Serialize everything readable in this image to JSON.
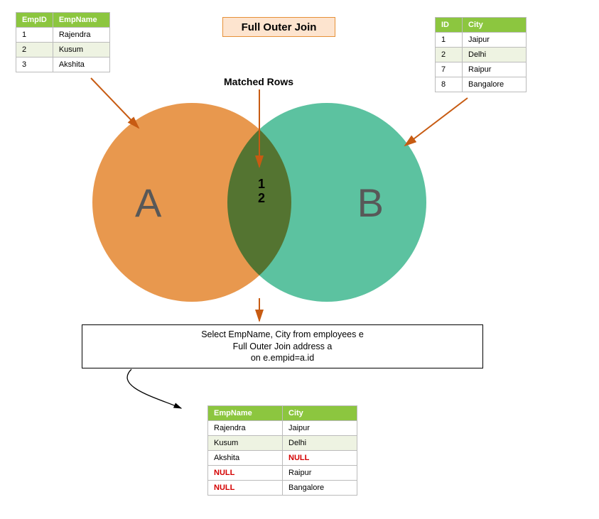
{
  "title": "Full Outer Join",
  "matched_label": "Matched Rows",
  "matched_values": [
    "1",
    "2"
  ],
  "venn": {
    "a_label": "A",
    "b_label": "B"
  },
  "left_table": {
    "headers": [
      "EmpID",
      "EmpName"
    ],
    "rows": [
      [
        "1",
        "Rajendra"
      ],
      [
        "2",
        "Kusum"
      ],
      [
        "3",
        "Akshita"
      ]
    ]
  },
  "right_table": {
    "headers": [
      "ID",
      "City"
    ],
    "rows": [
      [
        "1",
        "Jaipur"
      ],
      [
        "2",
        "Delhi"
      ],
      [
        "7",
        "Raipur"
      ],
      [
        "8",
        "Bangalore"
      ]
    ]
  },
  "sql": {
    "line1": "Select EmpName, City from employees e",
    "line2": "Full Outer Join address a",
    "line3": "on e.empid=a.id"
  },
  "result_table": {
    "headers": [
      "EmpName",
      "City"
    ],
    "rows": [
      {
        "c0": "Rajendra",
        "c1": "Jaipur"
      },
      {
        "c0": "Kusum",
        "c1": "Delhi"
      },
      {
        "c0": "Akshita",
        "c1": "NULL",
        "n1": true
      },
      {
        "c0": "NULL",
        "c1": "Raipur",
        "n0": true
      },
      {
        "c0": "NULL",
        "c1": "Bangalore",
        "n0": true
      }
    ]
  }
}
